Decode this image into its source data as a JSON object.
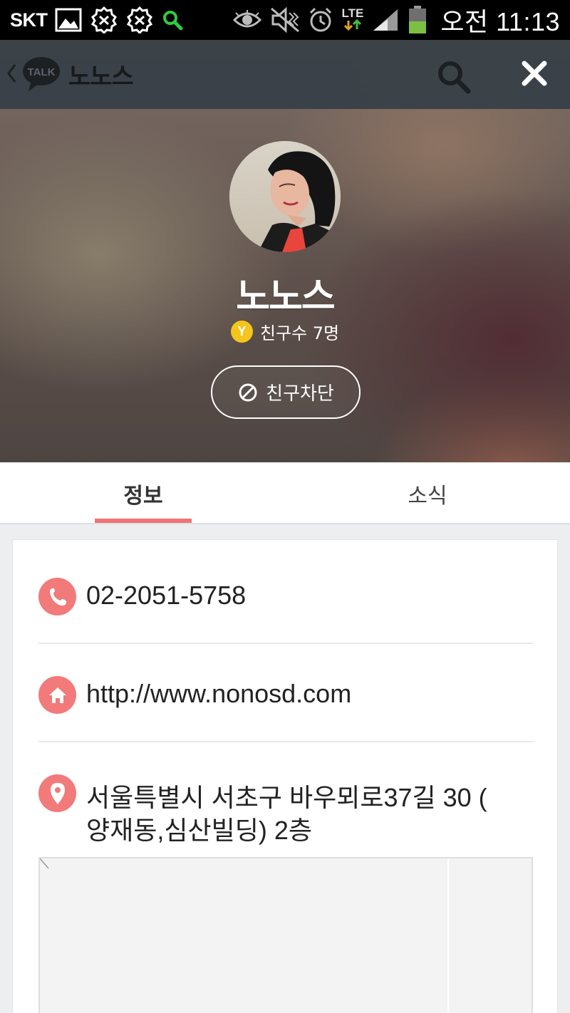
{
  "status_bar": {
    "carrier": "SKT",
    "network": "LTE",
    "time": "오전 11:13",
    "icons": [
      "gallery-icon",
      "notification-icon",
      "notification-icon",
      "search-icon",
      "eye-icon",
      "mute-icon",
      "alarm-icon",
      "lte-icon",
      "signal-icon",
      "battery-icon"
    ]
  },
  "app_bar": {
    "logo_text": "TALK",
    "title": "노노스"
  },
  "profile": {
    "name": "노노스",
    "badge_letter": "Y",
    "friend_count": "친구수 7명",
    "block_label": "친구차단"
  },
  "tabs": [
    {
      "label": "정보",
      "active": true
    },
    {
      "label": "소식",
      "active": false
    }
  ],
  "info": {
    "phone": "02-2051-5758",
    "website": "http://www.nonosd.com",
    "address_line1": "서울특별시 서초구 바우뫼로37길 30 (",
    "address_line2": "양재동,심산빌딩) 2층"
  },
  "colors": {
    "accent": "#f27a7a",
    "badge": "#f5c51c",
    "app_bar": "#363e46"
  }
}
